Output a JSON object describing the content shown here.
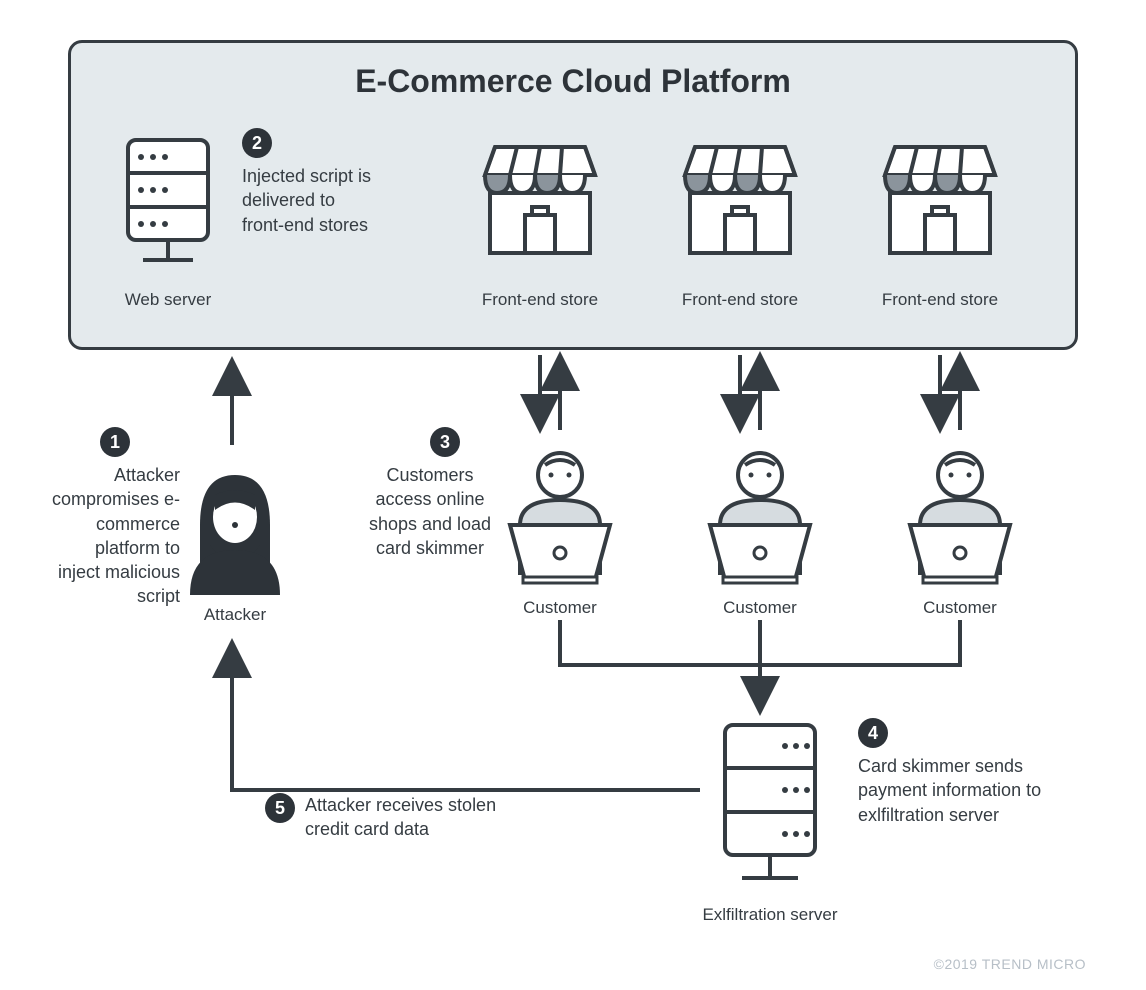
{
  "platform": {
    "title": "E-Commerce Cloud Platform"
  },
  "icons": {
    "webserver": "Web server",
    "store1": "Front-end store",
    "store2": "Front-end store",
    "store3": "Front-end store",
    "attacker": "Attacker",
    "customer1": "Customer",
    "customer2": "Customer",
    "customer3": "Customer",
    "exfil": "Exlfiltration server"
  },
  "steps": {
    "s1": {
      "num": "1",
      "text": "Attacker compromises e-commerce platform to inject malicious script"
    },
    "s2": {
      "num": "2",
      "text": "Injected script is delivered to front-end stores"
    },
    "s3": {
      "num": "3",
      "text": "Customers access online shops and load card skimmer"
    },
    "s4": {
      "num": "4",
      "text": "Card skimmer sends payment information to exlfiltration server"
    },
    "s5": {
      "num": "5",
      "text": "Attacker receives stolen credit card data"
    }
  },
  "footer": {
    "copyright": "©2019 TREND MICRO"
  }
}
